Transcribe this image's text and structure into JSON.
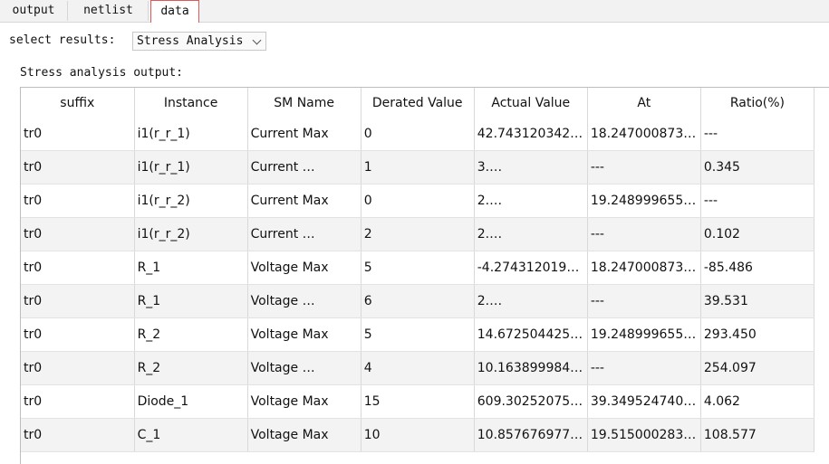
{
  "tabs": [
    "output",
    "netlist",
    "data"
  ],
  "selected_tab": "data",
  "select": {
    "label": "select results:",
    "value": "Stress Analysis"
  },
  "section_label": "Stress analysis output:",
  "table": {
    "columns": [
      "suffix",
      "Instance",
      "SM Name",
      "Derated Value",
      "Actual Value",
      "At",
      "Ratio(%)"
    ],
    "rows": [
      [
        "tr0",
        "i1(r_r_1)",
        "Current Max",
        "0",
        "42.743120342…",
        "18.247000873…",
        "---"
      ],
      [
        "tr0",
        "i1(r_r_1)",
        "Current …",
        "1",
        "3.…",
        "---",
        "0.345"
      ],
      [
        "tr0",
        "i1(r_r_2)",
        "Current Max",
        "0",
        "2.…",
        "19.248999655…",
        "---"
      ],
      [
        "tr0",
        "i1(r_r_2)",
        "Current …",
        "2",
        "2.…",
        "---",
        "0.102"
      ],
      [
        "tr0",
        "R_1",
        "Voltage Max",
        "5",
        "-4.274312019…",
        "18.247000873…",
        "-85.486"
      ],
      [
        "tr0",
        "R_1",
        "Voltage …",
        "6",
        "2.…",
        "---",
        "39.531"
      ],
      [
        "tr0",
        "R_2",
        "Voltage Max",
        "5",
        "14.672504425…",
        "19.248999655…",
        "293.450"
      ],
      [
        "tr0",
        "R_2",
        "Voltage …",
        "4",
        "10.163899984…",
        "---",
        "254.097"
      ],
      [
        "tr0",
        "Diode_1",
        "Voltage Max",
        "15",
        "609.30252075…",
        "39.349524740…",
        "4.062"
      ],
      [
        "tr0",
        "C_1",
        "Voltage Max",
        "10",
        "10.857676977…",
        "19.515000283…",
        "108.577"
      ]
    ]
  },
  "colors": {
    "active_tab_border": "#e0585a",
    "alt_row": "#f3f3f3"
  }
}
